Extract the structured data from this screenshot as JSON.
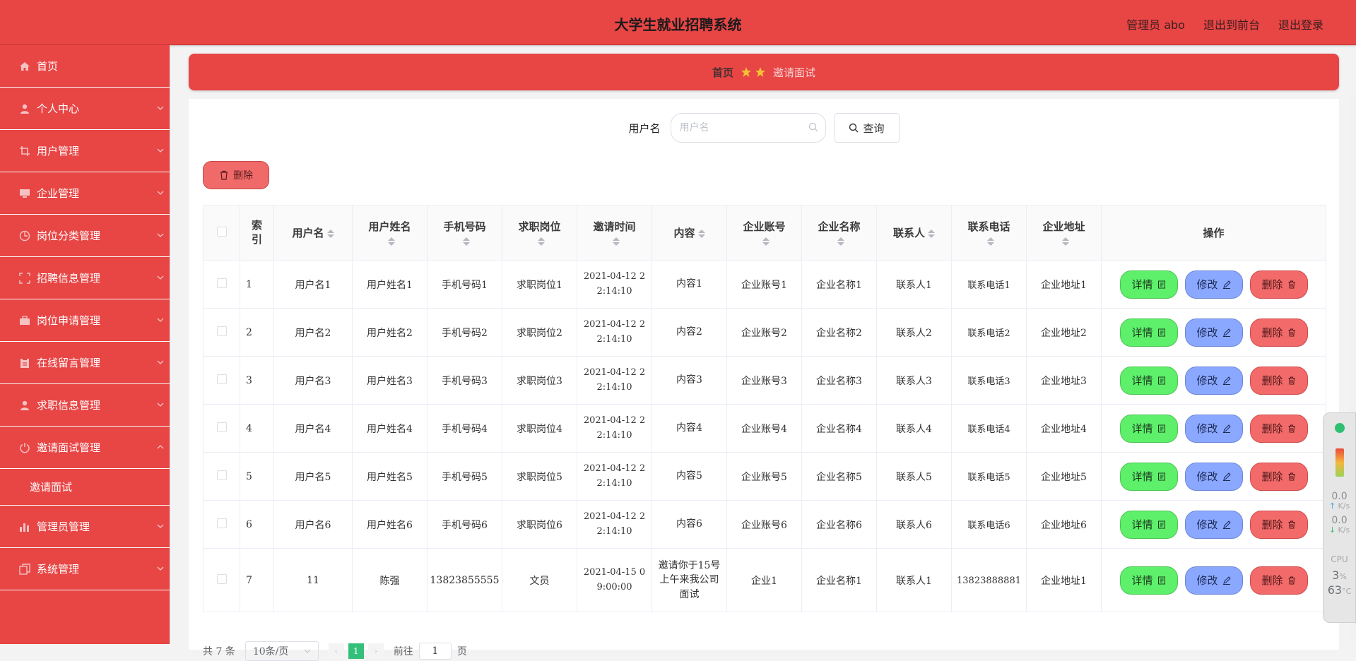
{
  "header": {
    "title": "大学生就业招聘系统",
    "links": [
      "管理员 abo",
      "退出到前台",
      "退出登录"
    ]
  },
  "sidebar": {
    "items": [
      {
        "label": "首页",
        "icon": "home-icon",
        "expandable": false
      },
      {
        "label": "个人中心",
        "icon": "user-icon",
        "expandable": true
      },
      {
        "label": "用户管理",
        "icon": "crop-icon",
        "expandable": true
      },
      {
        "label": "企业管理",
        "icon": "monitor-icon",
        "expandable": true
      },
      {
        "label": "岗位分类管理",
        "icon": "compass-icon",
        "expandable": true
      },
      {
        "label": "招聘信息管理",
        "icon": "fullscreen-icon",
        "expandable": true
      },
      {
        "label": "岗位申请管理",
        "icon": "briefcase-icon",
        "expandable": true
      },
      {
        "label": "在线留言管理",
        "icon": "clipboard-icon",
        "expandable": true
      },
      {
        "label": "求职信息管理",
        "icon": "user-icon",
        "expandable": true
      },
      {
        "label": "邀请面试管理",
        "icon": "power-icon",
        "expandable": true,
        "open": true
      },
      {
        "label": "管理员管理",
        "icon": "bar-chart-icon",
        "expandable": true
      },
      {
        "label": "系统管理",
        "icon": "copy-icon",
        "expandable": true
      }
    ],
    "submenu": {
      "label": "邀请面试"
    }
  },
  "breadcrumb": {
    "home": "首页",
    "current": "邀请面试"
  },
  "search": {
    "label": "用户名",
    "placeholder": "用户名",
    "button": "查询"
  },
  "toolbar": {
    "delete_label": "删除"
  },
  "table": {
    "columns": [
      "索引",
      "用户名",
      "用户姓名",
      "手机号码",
      "求职岗位",
      "邀请时间",
      "内容",
      "企业账号",
      "企业名称",
      "联系人",
      "联系电话",
      "企业地址",
      "操作"
    ],
    "rows": [
      {
        "idx": "1",
        "username": "用户名1",
        "realname": "用户姓名1",
        "phone": "手机号码1",
        "job": "求职岗位1",
        "time_a": "2021-04-12 2",
        "time_b": "2:14:10",
        "content": "内容1",
        "account": "企业账号1",
        "company": "企业名称1",
        "contact": "联系人1",
        "tel": "联系电话1",
        "address": "企业地址1"
      },
      {
        "idx": "2",
        "username": "用户名2",
        "realname": "用户姓名2",
        "phone": "手机号码2",
        "job": "求职岗位2",
        "time_a": "2021-04-12 2",
        "time_b": "2:14:10",
        "content": "内容2",
        "account": "企业账号2",
        "company": "企业名称2",
        "contact": "联系人2",
        "tel": "联系电话2",
        "address": "企业地址2"
      },
      {
        "idx": "3",
        "username": "用户名3",
        "realname": "用户姓名3",
        "phone": "手机号码3",
        "job": "求职岗位3",
        "time_a": "2021-04-12 2",
        "time_b": "2:14:10",
        "content": "内容3",
        "account": "企业账号3",
        "company": "企业名称3",
        "contact": "联系人3",
        "tel": "联系电话3",
        "address": "企业地址3"
      },
      {
        "idx": "4",
        "username": "用户名4",
        "realname": "用户姓名4",
        "phone": "手机号码4",
        "job": "求职岗位4",
        "time_a": "2021-04-12 2",
        "time_b": "2:14:10",
        "content": "内容4",
        "account": "企业账号4",
        "company": "企业名称4",
        "contact": "联系人4",
        "tel": "联系电话4",
        "address": "企业地址4"
      },
      {
        "idx": "5",
        "username": "用户名5",
        "realname": "用户姓名5",
        "phone": "手机号码5",
        "job": "求职岗位5",
        "time_a": "2021-04-12 2",
        "time_b": "2:14:10",
        "content": "内容5",
        "account": "企业账号5",
        "company": "企业名称5",
        "contact": "联系人5",
        "tel": "联系电话5",
        "address": "企业地址5"
      },
      {
        "idx": "6",
        "username": "用户名6",
        "realname": "用户姓名6",
        "phone": "手机号码6",
        "job": "求职岗位6",
        "time_a": "2021-04-12 2",
        "time_b": "2:14:10",
        "content": "内容6",
        "account": "企业账号6",
        "company": "企业名称6",
        "contact": "联系人6",
        "tel": "联系电话6",
        "address": "企业地址6"
      },
      {
        "idx": "7",
        "username": "11",
        "realname": "陈强",
        "phone": "13823855555",
        "job": "文员",
        "time_a": "2021-04-15 0",
        "time_b": "9:00:00",
        "content": "邀请你于15号上午来我公司面试",
        "account": "企业1",
        "company": "企业名称1",
        "contact": "联系人1",
        "tel": "13823888881",
        "address": "企业地址1"
      }
    ],
    "actions": {
      "detail": "详情",
      "edit": "修改",
      "delete": "删除"
    }
  },
  "pagination": {
    "total": "共 7 条",
    "page_size": "10条/页",
    "current_page": "1",
    "goto_label": "前往",
    "goto_value": "1",
    "page_suffix": "页"
  },
  "monitor": {
    "up_value": "0.0",
    "down_value": "0.0",
    "unit": "K/s",
    "cpu_label": "CPU",
    "cpu_pct": "3",
    "pct_sign": "%",
    "temp": "63",
    "temp_unit": "°C"
  },
  "colors": {
    "primary": "#e84545",
    "detail": "#5ef06a",
    "edit": "#8aa8ff",
    "delete": "#f26a6a",
    "page_active": "#35c07a"
  }
}
